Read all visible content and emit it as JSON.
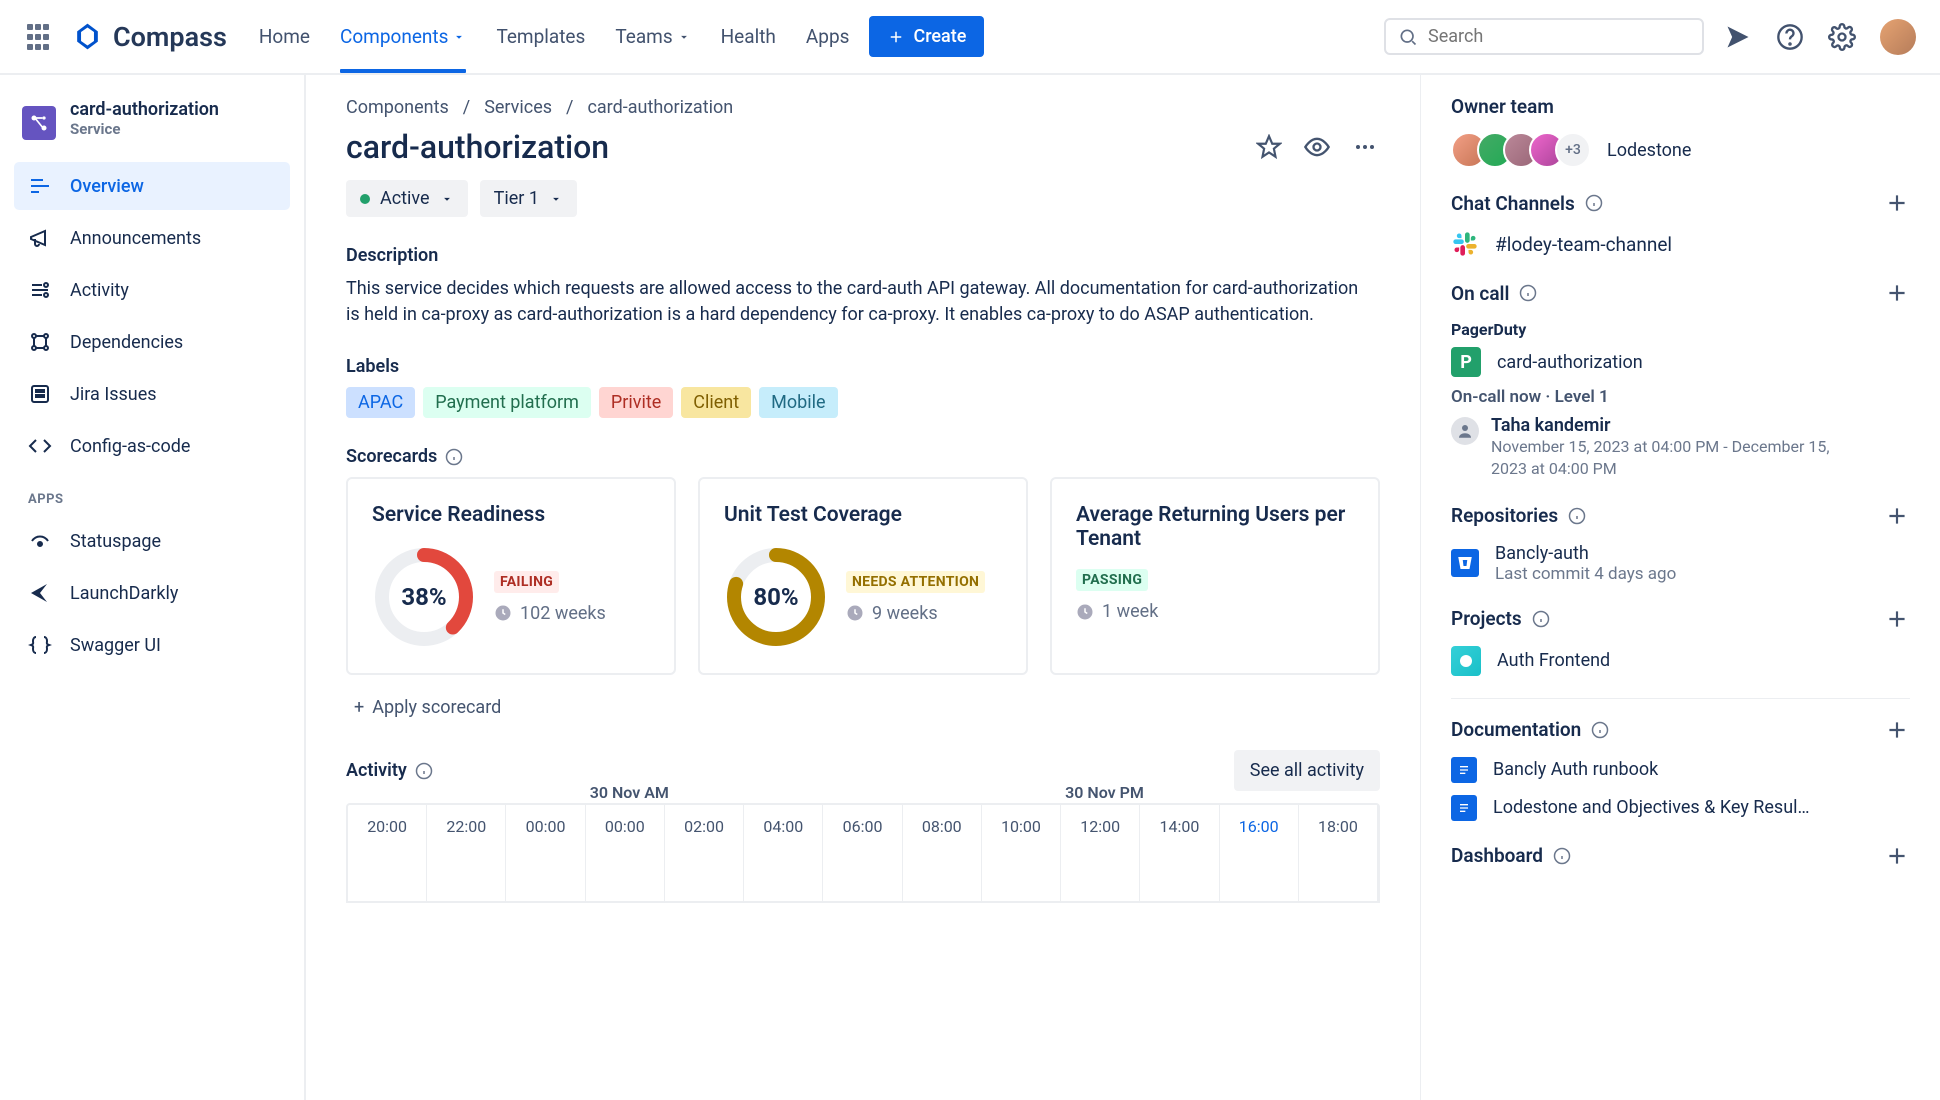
{
  "app": {
    "name": "Compass"
  },
  "topnav": {
    "links": [
      "Home",
      "Components",
      "Templates",
      "Teams",
      "Health",
      "Apps"
    ],
    "active": "Components",
    "create": "Create",
    "search_placeholder": "Search"
  },
  "sidebar": {
    "component": {
      "name": "card-authorization",
      "type": "Service"
    },
    "items": [
      {
        "label": "Overview",
        "active": true
      },
      {
        "label": "Announcements"
      },
      {
        "label": "Activity"
      },
      {
        "label": "Dependencies"
      },
      {
        "label": "Jira Issues"
      },
      {
        "label": "Config-as-code"
      }
    ],
    "apps_header": "APPS",
    "apps": [
      {
        "label": "Statuspage"
      },
      {
        "label": "LaunchDarkly"
      },
      {
        "label": "Swagger UI"
      }
    ]
  },
  "breadcrumb": [
    "Components",
    "Services",
    "card-authorization"
  ],
  "title": "card-authorization",
  "status": "Active",
  "tier": "Tier 1",
  "desc_h": "Description",
  "description": "This service decides which requests are allowed access to the card-auth API gateway. All documentation for card-authorization is held in ca-proxy as card-authorization is a hard dependency for ca-proxy. It enables ca-proxy to do ASAP authentication.",
  "labels_h": "Labels",
  "labels": [
    "APAC",
    "Payment platform",
    "Privite",
    "Client",
    "Mobile"
  ],
  "scorecards_h": "Scorecards",
  "scorecards": [
    {
      "title": "Service Readiness",
      "pct": "38%",
      "pct_n": 38,
      "status": "FAILING",
      "weeks": "102 weeks"
    },
    {
      "title": "Unit Test Coverage",
      "pct": "80%",
      "pct_n": 80,
      "status": "NEEDS ATTENTION",
      "weeks": "9 weeks"
    },
    {
      "title": "Average Returning Users per Tenant",
      "pct": "",
      "status": "PASSING",
      "weeks": "1 week"
    }
  ],
  "apply_scorecard": "Apply scorecard",
  "activity_h": "Activity",
  "see_all": "See all activity",
  "timeline": {
    "am": "30 Nov AM",
    "pm": "30 Nov PM",
    "hours": [
      "20:00",
      "22:00",
      "00:00",
      "00:00",
      "02:00",
      "04:00",
      "06:00",
      "08:00",
      "10:00",
      "12:00",
      "14:00",
      "16:00",
      "18:00"
    ],
    "current": "16:00"
  },
  "right": {
    "owner_h": "Owner team",
    "owner_more": "+3",
    "team": "Lodestone",
    "chat_h": "Chat Channels",
    "chat_channel": "#lodey-team-channel",
    "oncall_h": "On call",
    "oncall_provider": "PagerDuty",
    "oncall_service": "card-authorization",
    "oncall_now": "On-call now · Level 1",
    "oncall_person": "Taha kandemir",
    "oncall_time": "November 15, 2023 at 04:00 PM - December 15, 2023 at 04:00 PM",
    "repo_h": "Repositories",
    "repo_name": "Bancly-auth",
    "repo_sub": "Last commit 4 days ago",
    "proj_h": "Projects",
    "proj_name": "Auth Frontend",
    "docs_h": "Documentation",
    "doc1": "Bancly Auth runbook",
    "doc2": "Lodestone and Objectives & Key Resul…",
    "dash_h": "Dashboard"
  }
}
